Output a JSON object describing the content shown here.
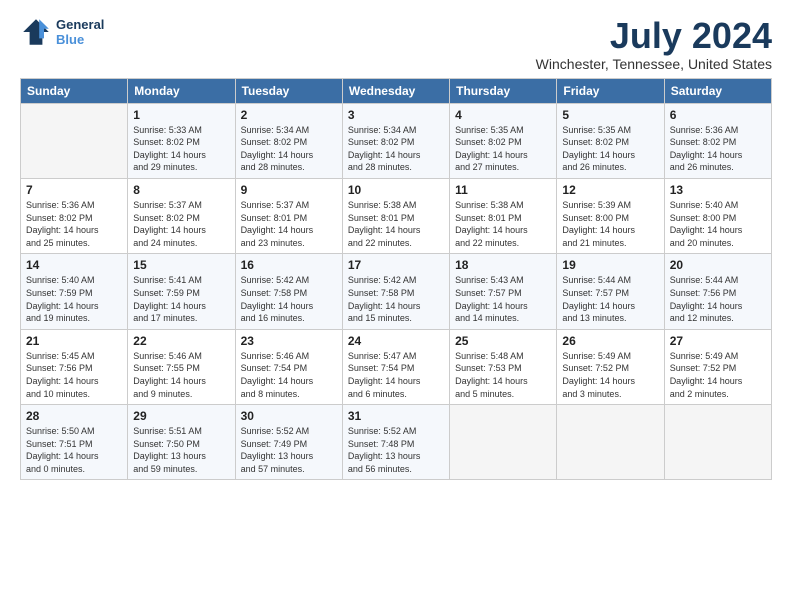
{
  "logo": {
    "line1": "General",
    "line2": "Blue"
  },
  "title": "July 2024",
  "subtitle": "Winchester, Tennessee, United States",
  "days_of_week": [
    "Sunday",
    "Monday",
    "Tuesday",
    "Wednesday",
    "Thursday",
    "Friday",
    "Saturday"
  ],
  "weeks": [
    [
      {
        "day": "",
        "detail": ""
      },
      {
        "day": "1",
        "detail": "Sunrise: 5:33 AM\nSunset: 8:02 PM\nDaylight: 14 hours\nand 29 minutes."
      },
      {
        "day": "2",
        "detail": "Sunrise: 5:34 AM\nSunset: 8:02 PM\nDaylight: 14 hours\nand 28 minutes."
      },
      {
        "day": "3",
        "detail": "Sunrise: 5:34 AM\nSunset: 8:02 PM\nDaylight: 14 hours\nand 28 minutes."
      },
      {
        "day": "4",
        "detail": "Sunrise: 5:35 AM\nSunset: 8:02 PM\nDaylight: 14 hours\nand 27 minutes."
      },
      {
        "day": "5",
        "detail": "Sunrise: 5:35 AM\nSunset: 8:02 PM\nDaylight: 14 hours\nand 26 minutes."
      },
      {
        "day": "6",
        "detail": "Sunrise: 5:36 AM\nSunset: 8:02 PM\nDaylight: 14 hours\nand 26 minutes."
      }
    ],
    [
      {
        "day": "7",
        "detail": "Sunrise: 5:36 AM\nSunset: 8:02 PM\nDaylight: 14 hours\nand 25 minutes."
      },
      {
        "day": "8",
        "detail": "Sunrise: 5:37 AM\nSunset: 8:02 PM\nDaylight: 14 hours\nand 24 minutes."
      },
      {
        "day": "9",
        "detail": "Sunrise: 5:37 AM\nSunset: 8:01 PM\nDaylight: 14 hours\nand 23 minutes."
      },
      {
        "day": "10",
        "detail": "Sunrise: 5:38 AM\nSunset: 8:01 PM\nDaylight: 14 hours\nand 22 minutes."
      },
      {
        "day": "11",
        "detail": "Sunrise: 5:38 AM\nSunset: 8:01 PM\nDaylight: 14 hours\nand 22 minutes."
      },
      {
        "day": "12",
        "detail": "Sunrise: 5:39 AM\nSunset: 8:00 PM\nDaylight: 14 hours\nand 21 minutes."
      },
      {
        "day": "13",
        "detail": "Sunrise: 5:40 AM\nSunset: 8:00 PM\nDaylight: 14 hours\nand 20 minutes."
      }
    ],
    [
      {
        "day": "14",
        "detail": "Sunrise: 5:40 AM\nSunset: 7:59 PM\nDaylight: 14 hours\nand 19 minutes."
      },
      {
        "day": "15",
        "detail": "Sunrise: 5:41 AM\nSunset: 7:59 PM\nDaylight: 14 hours\nand 17 minutes."
      },
      {
        "day": "16",
        "detail": "Sunrise: 5:42 AM\nSunset: 7:58 PM\nDaylight: 14 hours\nand 16 minutes."
      },
      {
        "day": "17",
        "detail": "Sunrise: 5:42 AM\nSunset: 7:58 PM\nDaylight: 14 hours\nand 15 minutes."
      },
      {
        "day": "18",
        "detail": "Sunrise: 5:43 AM\nSunset: 7:57 PM\nDaylight: 14 hours\nand 14 minutes."
      },
      {
        "day": "19",
        "detail": "Sunrise: 5:44 AM\nSunset: 7:57 PM\nDaylight: 14 hours\nand 13 minutes."
      },
      {
        "day": "20",
        "detail": "Sunrise: 5:44 AM\nSunset: 7:56 PM\nDaylight: 14 hours\nand 12 minutes."
      }
    ],
    [
      {
        "day": "21",
        "detail": "Sunrise: 5:45 AM\nSunset: 7:56 PM\nDaylight: 14 hours\nand 10 minutes."
      },
      {
        "day": "22",
        "detail": "Sunrise: 5:46 AM\nSunset: 7:55 PM\nDaylight: 14 hours\nand 9 minutes."
      },
      {
        "day": "23",
        "detail": "Sunrise: 5:46 AM\nSunset: 7:54 PM\nDaylight: 14 hours\nand 8 minutes."
      },
      {
        "day": "24",
        "detail": "Sunrise: 5:47 AM\nSunset: 7:54 PM\nDaylight: 14 hours\nand 6 minutes."
      },
      {
        "day": "25",
        "detail": "Sunrise: 5:48 AM\nSunset: 7:53 PM\nDaylight: 14 hours\nand 5 minutes."
      },
      {
        "day": "26",
        "detail": "Sunrise: 5:49 AM\nSunset: 7:52 PM\nDaylight: 14 hours\nand 3 minutes."
      },
      {
        "day": "27",
        "detail": "Sunrise: 5:49 AM\nSunset: 7:52 PM\nDaylight: 14 hours\nand 2 minutes."
      }
    ],
    [
      {
        "day": "28",
        "detail": "Sunrise: 5:50 AM\nSunset: 7:51 PM\nDaylight: 14 hours\nand 0 minutes."
      },
      {
        "day": "29",
        "detail": "Sunrise: 5:51 AM\nSunset: 7:50 PM\nDaylight: 13 hours\nand 59 minutes."
      },
      {
        "day": "30",
        "detail": "Sunrise: 5:52 AM\nSunset: 7:49 PM\nDaylight: 13 hours\nand 57 minutes."
      },
      {
        "day": "31",
        "detail": "Sunrise: 5:52 AM\nSunset: 7:48 PM\nDaylight: 13 hours\nand 56 minutes."
      },
      {
        "day": "",
        "detail": ""
      },
      {
        "day": "",
        "detail": ""
      },
      {
        "day": "",
        "detail": ""
      }
    ]
  ]
}
